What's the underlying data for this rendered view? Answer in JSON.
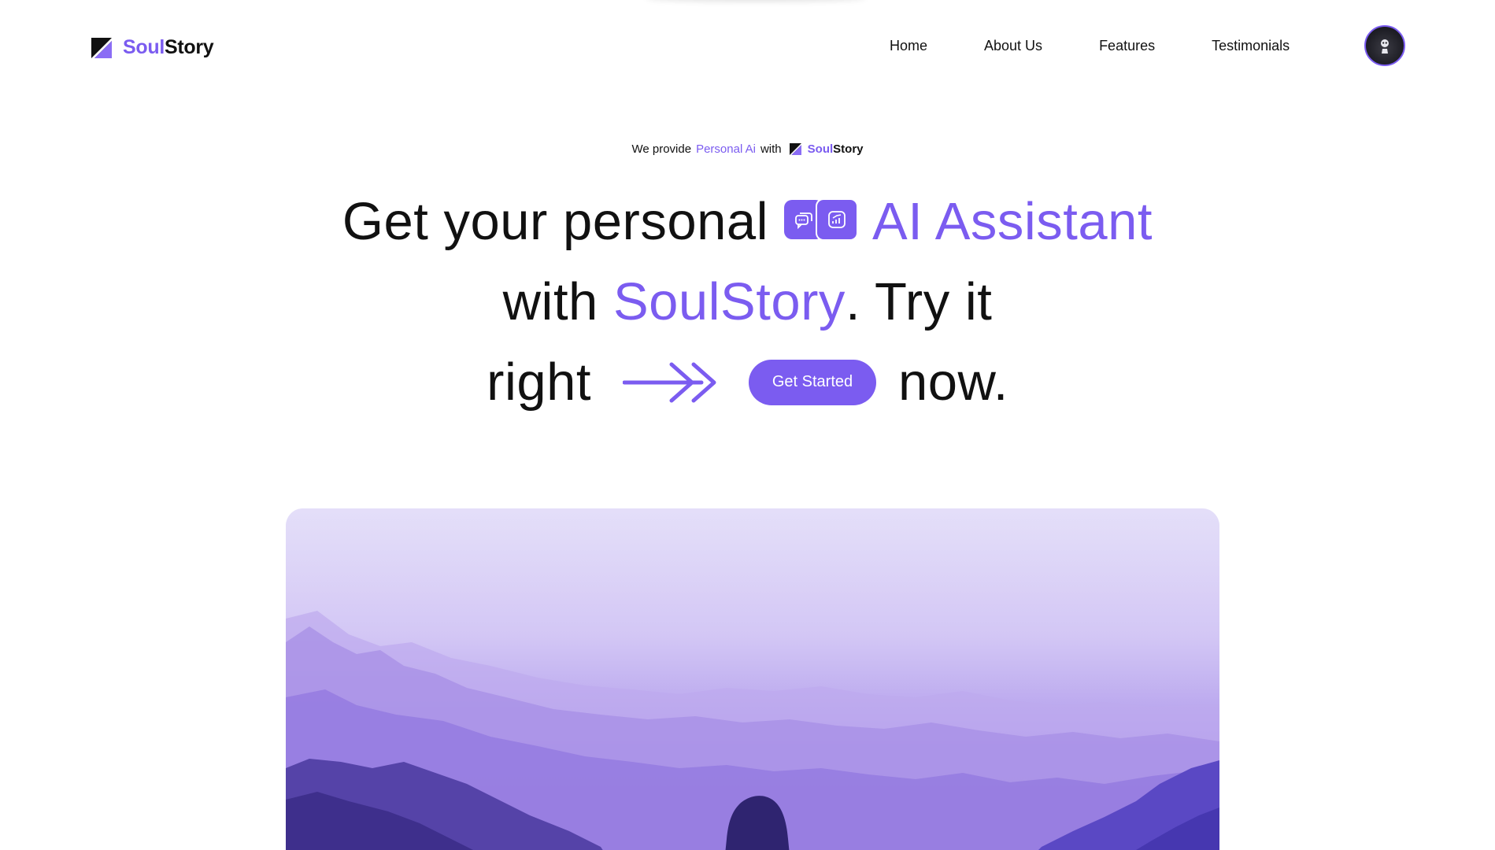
{
  "brand": {
    "part1": "Soul",
    "part2": "Story",
    "accent_color": "#7b5cf0",
    "logo_icon": "logo-mark-icon"
  },
  "nav": {
    "items": [
      {
        "label": "Home"
      },
      {
        "label": "About Us"
      },
      {
        "label": "Features"
      },
      {
        "label": "Testimonials"
      }
    ],
    "avatar_icon": "user-avatar-icon"
  },
  "eyebrow": {
    "prefix": "We provide",
    "highlight": "Personal Ai",
    "suffix": "with",
    "brand_part1": "Soul",
    "brand_part2": "Story"
  },
  "headline": {
    "line1_a": "Get your personal",
    "line1_b": "AI Assistant",
    "line2_a": "with",
    "line2_b": "SoulStory",
    "line2_c": ". Try it",
    "line3_a": "right",
    "line3_b": "now.",
    "chip_icons": [
      "chat-bubbles-icon",
      "growth-chart-icon"
    ],
    "arrow_icon": "double-arrow-right-icon"
  },
  "cta": {
    "label": "Get Started"
  },
  "hero": {
    "image": "mountain-landscape-with-hooded-person"
  }
}
